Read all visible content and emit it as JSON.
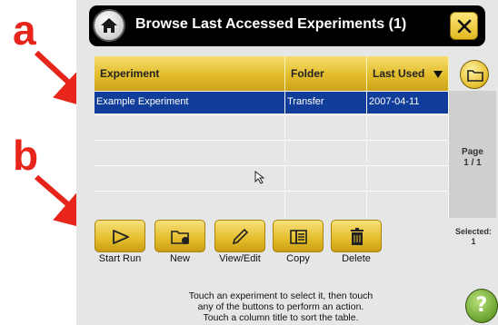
{
  "titlebar": {
    "title": "Browse Last Accessed Experiments (1)"
  },
  "table": {
    "columns": [
      "Experiment",
      "Folder",
      "Last Used"
    ],
    "rows": [
      {
        "experiment": "Example Experiment",
        "folder": "Transfer",
        "last_used": "2007-04-11"
      }
    ]
  },
  "pager": {
    "label": "Page",
    "value": "1 / 1"
  },
  "selection": {
    "label": "Selected:",
    "count": "1"
  },
  "actions": [
    {
      "label": "Start Run",
      "icon": "play-icon"
    },
    {
      "label": "New",
      "icon": "new-folder-icon"
    },
    {
      "label": "View/Edit",
      "icon": "pencil-icon"
    },
    {
      "label": "Copy",
      "icon": "copy-icon"
    },
    {
      "label": "Delete",
      "icon": "trash-icon"
    }
  ],
  "hint": {
    "line1": "Touch an experiment to select it, then touch",
    "line2": "any of the buttons to perform an action.",
    "line3": "Touch a column title to sort the table."
  },
  "help": {
    "label": "?"
  },
  "annotations": {
    "a": "a",
    "b": "b"
  },
  "colors": {
    "accent_yellow": "#e4bd2a",
    "selection_blue": "#103c9a",
    "annotation_red": "#e8251b",
    "guide_blue": "#2f9ed8"
  }
}
